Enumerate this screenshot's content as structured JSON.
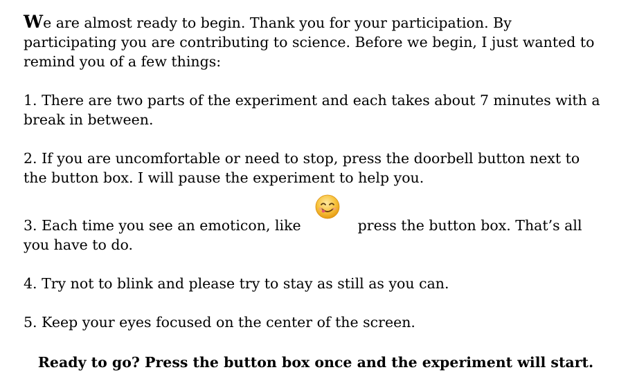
{
  "intro": {
    "first_letter": "W",
    "text": "e are almost ready to begin. Thank you for your participation. By participating you are contributing to science. Before we begin, I just wanted to remind you of a few things:"
  },
  "items": [
    {
      "text": "1. There are two parts of the experiment and each takes about 7 minutes with a break in between."
    },
    {
      "text": "2. If you are uncomfortable or need to stop, press the doorbell button next to the button box.  I will pause the experiment to help you."
    },
    {
      "text_before": "3. Each time you see an emoticon, like",
      "icon": "smiling-emoticon-icon",
      "text_after": "press the button box. That’s all you have to do."
    },
    {
      "text": "4. Try not to blink and please try to stay as still as you can."
    },
    {
      "text": "5. Keep your eyes focused on the center of the screen."
    }
  ],
  "closing": {
    "text": "Ready to go? Press the button box once and the experiment will start."
  }
}
